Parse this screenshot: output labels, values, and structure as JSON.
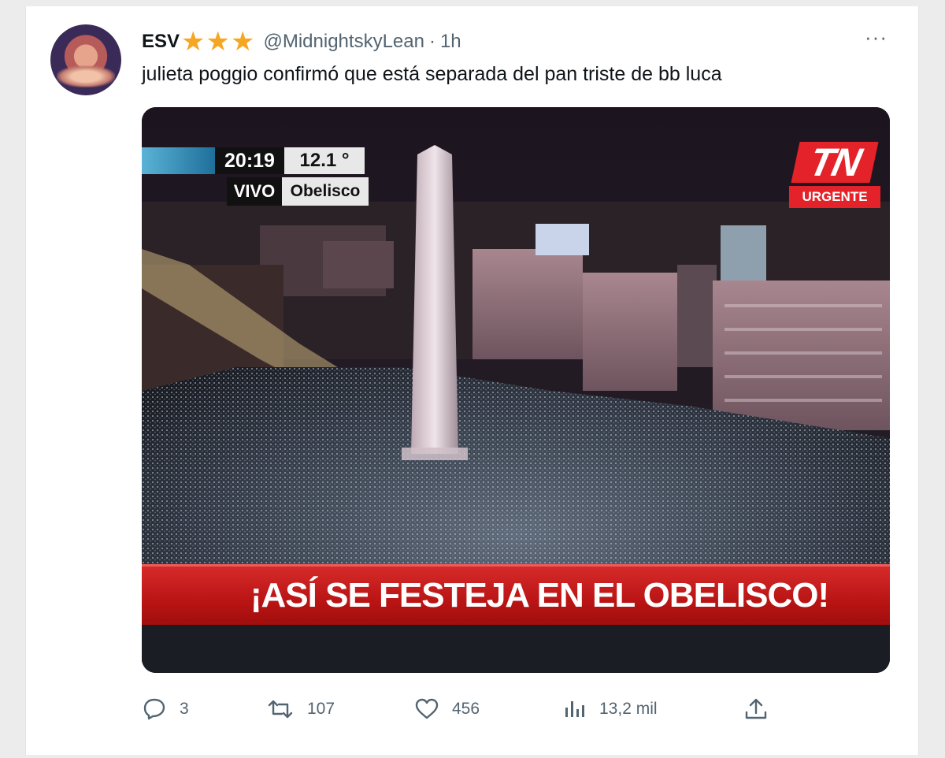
{
  "tweet": {
    "display_name": "ESV",
    "stars": [
      "★",
      "★",
      "★"
    ],
    "handle": "@MidnightskyLean",
    "separator": "·",
    "time": "1h",
    "more": "···",
    "text": "julieta poggio confirmó que está separada del pan triste de bb luca"
  },
  "media": {
    "clock_time": "20:19",
    "temperature": "12.1 °",
    "live_label": "VIVO",
    "location": "Obelisco",
    "channel_logo": "TN",
    "channel_tag": "URGENTE",
    "headline": "¡ASÍ SE FESTEJA EN EL OBELISCO!"
  },
  "actions": {
    "replies": "3",
    "retweets": "107",
    "likes": "456",
    "views": "13,2 mil"
  },
  "colors": {
    "accent_star": "#f5a623",
    "tn_red": "#e3222a",
    "muted_text": "#536471"
  }
}
